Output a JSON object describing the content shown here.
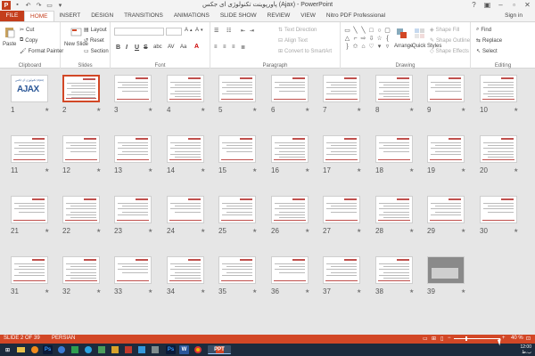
{
  "window": {
    "title": "پاورپوینت تکنولوژی ای جکس (Ajax) - PowerPoint",
    "help": "?",
    "signin": "Sign in"
  },
  "ribbon": {
    "tabs": [
      "FILE",
      "HOME",
      "INSERT",
      "DESIGN",
      "TRANSITIONS",
      "ANIMATIONS",
      "SLIDE SHOW",
      "REVIEW",
      "VIEW",
      "Nitro PDF Professional"
    ],
    "active_tab": "HOME",
    "clipboard": {
      "paste": "Paste",
      "cut": "Cut",
      "copy": "Copy",
      "format_painter": "Format Painter",
      "label": "Clipboard"
    },
    "slides": {
      "new_slide": "New Slide",
      "layout": "Layout",
      "reset": "Reset",
      "section": "Section",
      "label": "Slides"
    },
    "font": {
      "label": "Font",
      "bold": "B",
      "italic": "I",
      "underline": "U",
      "strike": "S",
      "shadow": "abc",
      "spacing": "AV",
      "case": "Aa"
    },
    "paragraph": {
      "text_direction": "Text Direction",
      "align_text": "Align Text",
      "convert_smartart": "Convert to SmartArt",
      "label": "Paragraph"
    },
    "drawing": {
      "arrange": "Arrange",
      "quick_styles": "Quick Styles",
      "shape_fill": "Shape Fill",
      "shape_outline": "Shape Outline",
      "shape_effects": "Shape Effects",
      "label": "Drawing"
    },
    "editing": {
      "find": "Find",
      "replace": "Replace",
      "select": "Select",
      "label": "Editing"
    }
  },
  "slide_sorter": {
    "selected": 2,
    "slides": [
      "1",
      "2",
      "3",
      "4",
      "5",
      "6",
      "7",
      "8",
      "9",
      "10",
      "11",
      "12",
      "13",
      "14",
      "15",
      "16",
      "17",
      "18",
      "19",
      "20",
      "21",
      "22",
      "23",
      "24",
      "25",
      "26",
      "27",
      "28",
      "29",
      "30",
      "31",
      "32",
      "33",
      "34",
      "35",
      "36",
      "37",
      "38",
      "39"
    ],
    "star": "★",
    "title_slide": {
      "caption": "تکنولوژی ای جکس (Ajax)",
      "logo": "AJAX"
    }
  },
  "status": {
    "slide_info": "SLIDE 2 OF 39",
    "language": "PERSIAN",
    "zoom": "40 %",
    "zoom_percent": 40
  },
  "taskbar": {
    "apps": [
      "Ps",
      "Ps",
      "W",
      "PPT"
    ],
    "time": "12:00",
    "date": "ب.ظ"
  },
  "colors": {
    "accent": "#d24726",
    "file_tab": "#c43e1c",
    "taskbar": "#1c2b3d"
  }
}
